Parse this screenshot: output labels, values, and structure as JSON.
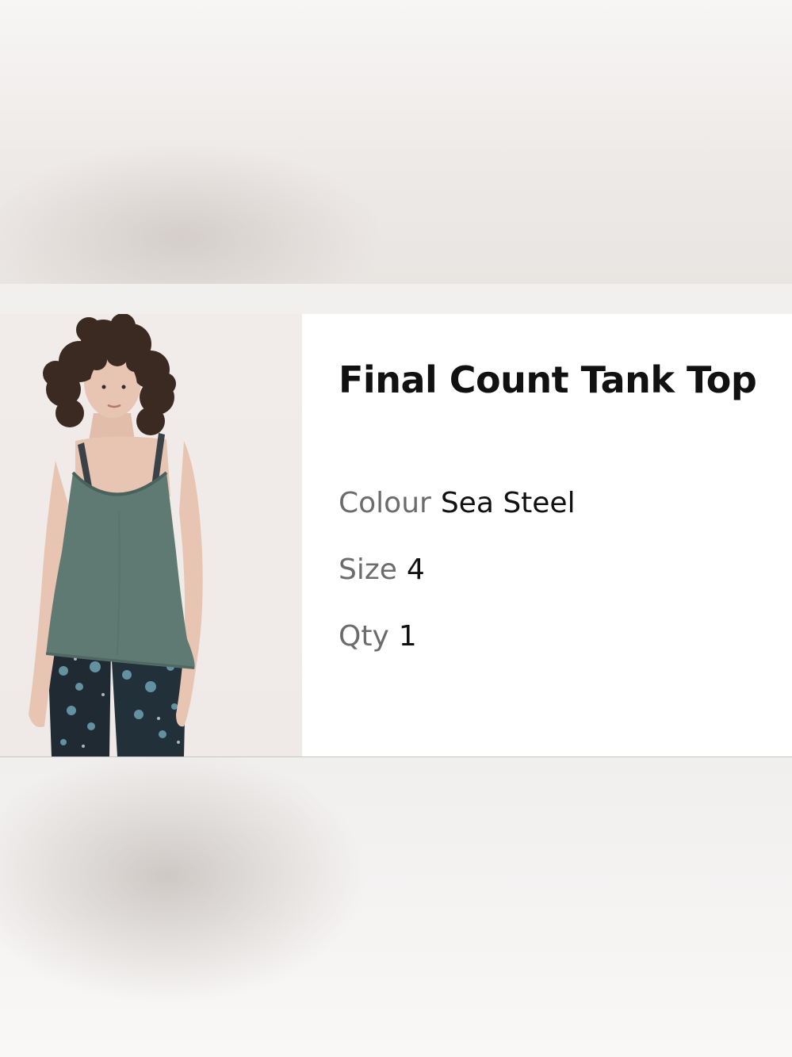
{
  "product": {
    "title": "Final Count Tank Top",
    "image_alt": "Model wearing Final Count Tank Top"
  },
  "attributes": {
    "colour": {
      "label": "Colour",
      "value": "Sea Steel"
    },
    "size": {
      "label": "Size",
      "value": "4"
    },
    "qty": {
      "label": "Qty",
      "value": "1"
    }
  },
  "colors": {
    "card_background": "#ffffff",
    "title_text": "#111111",
    "label_text": "#6c6c6c",
    "garment": "#5f7a72"
  }
}
